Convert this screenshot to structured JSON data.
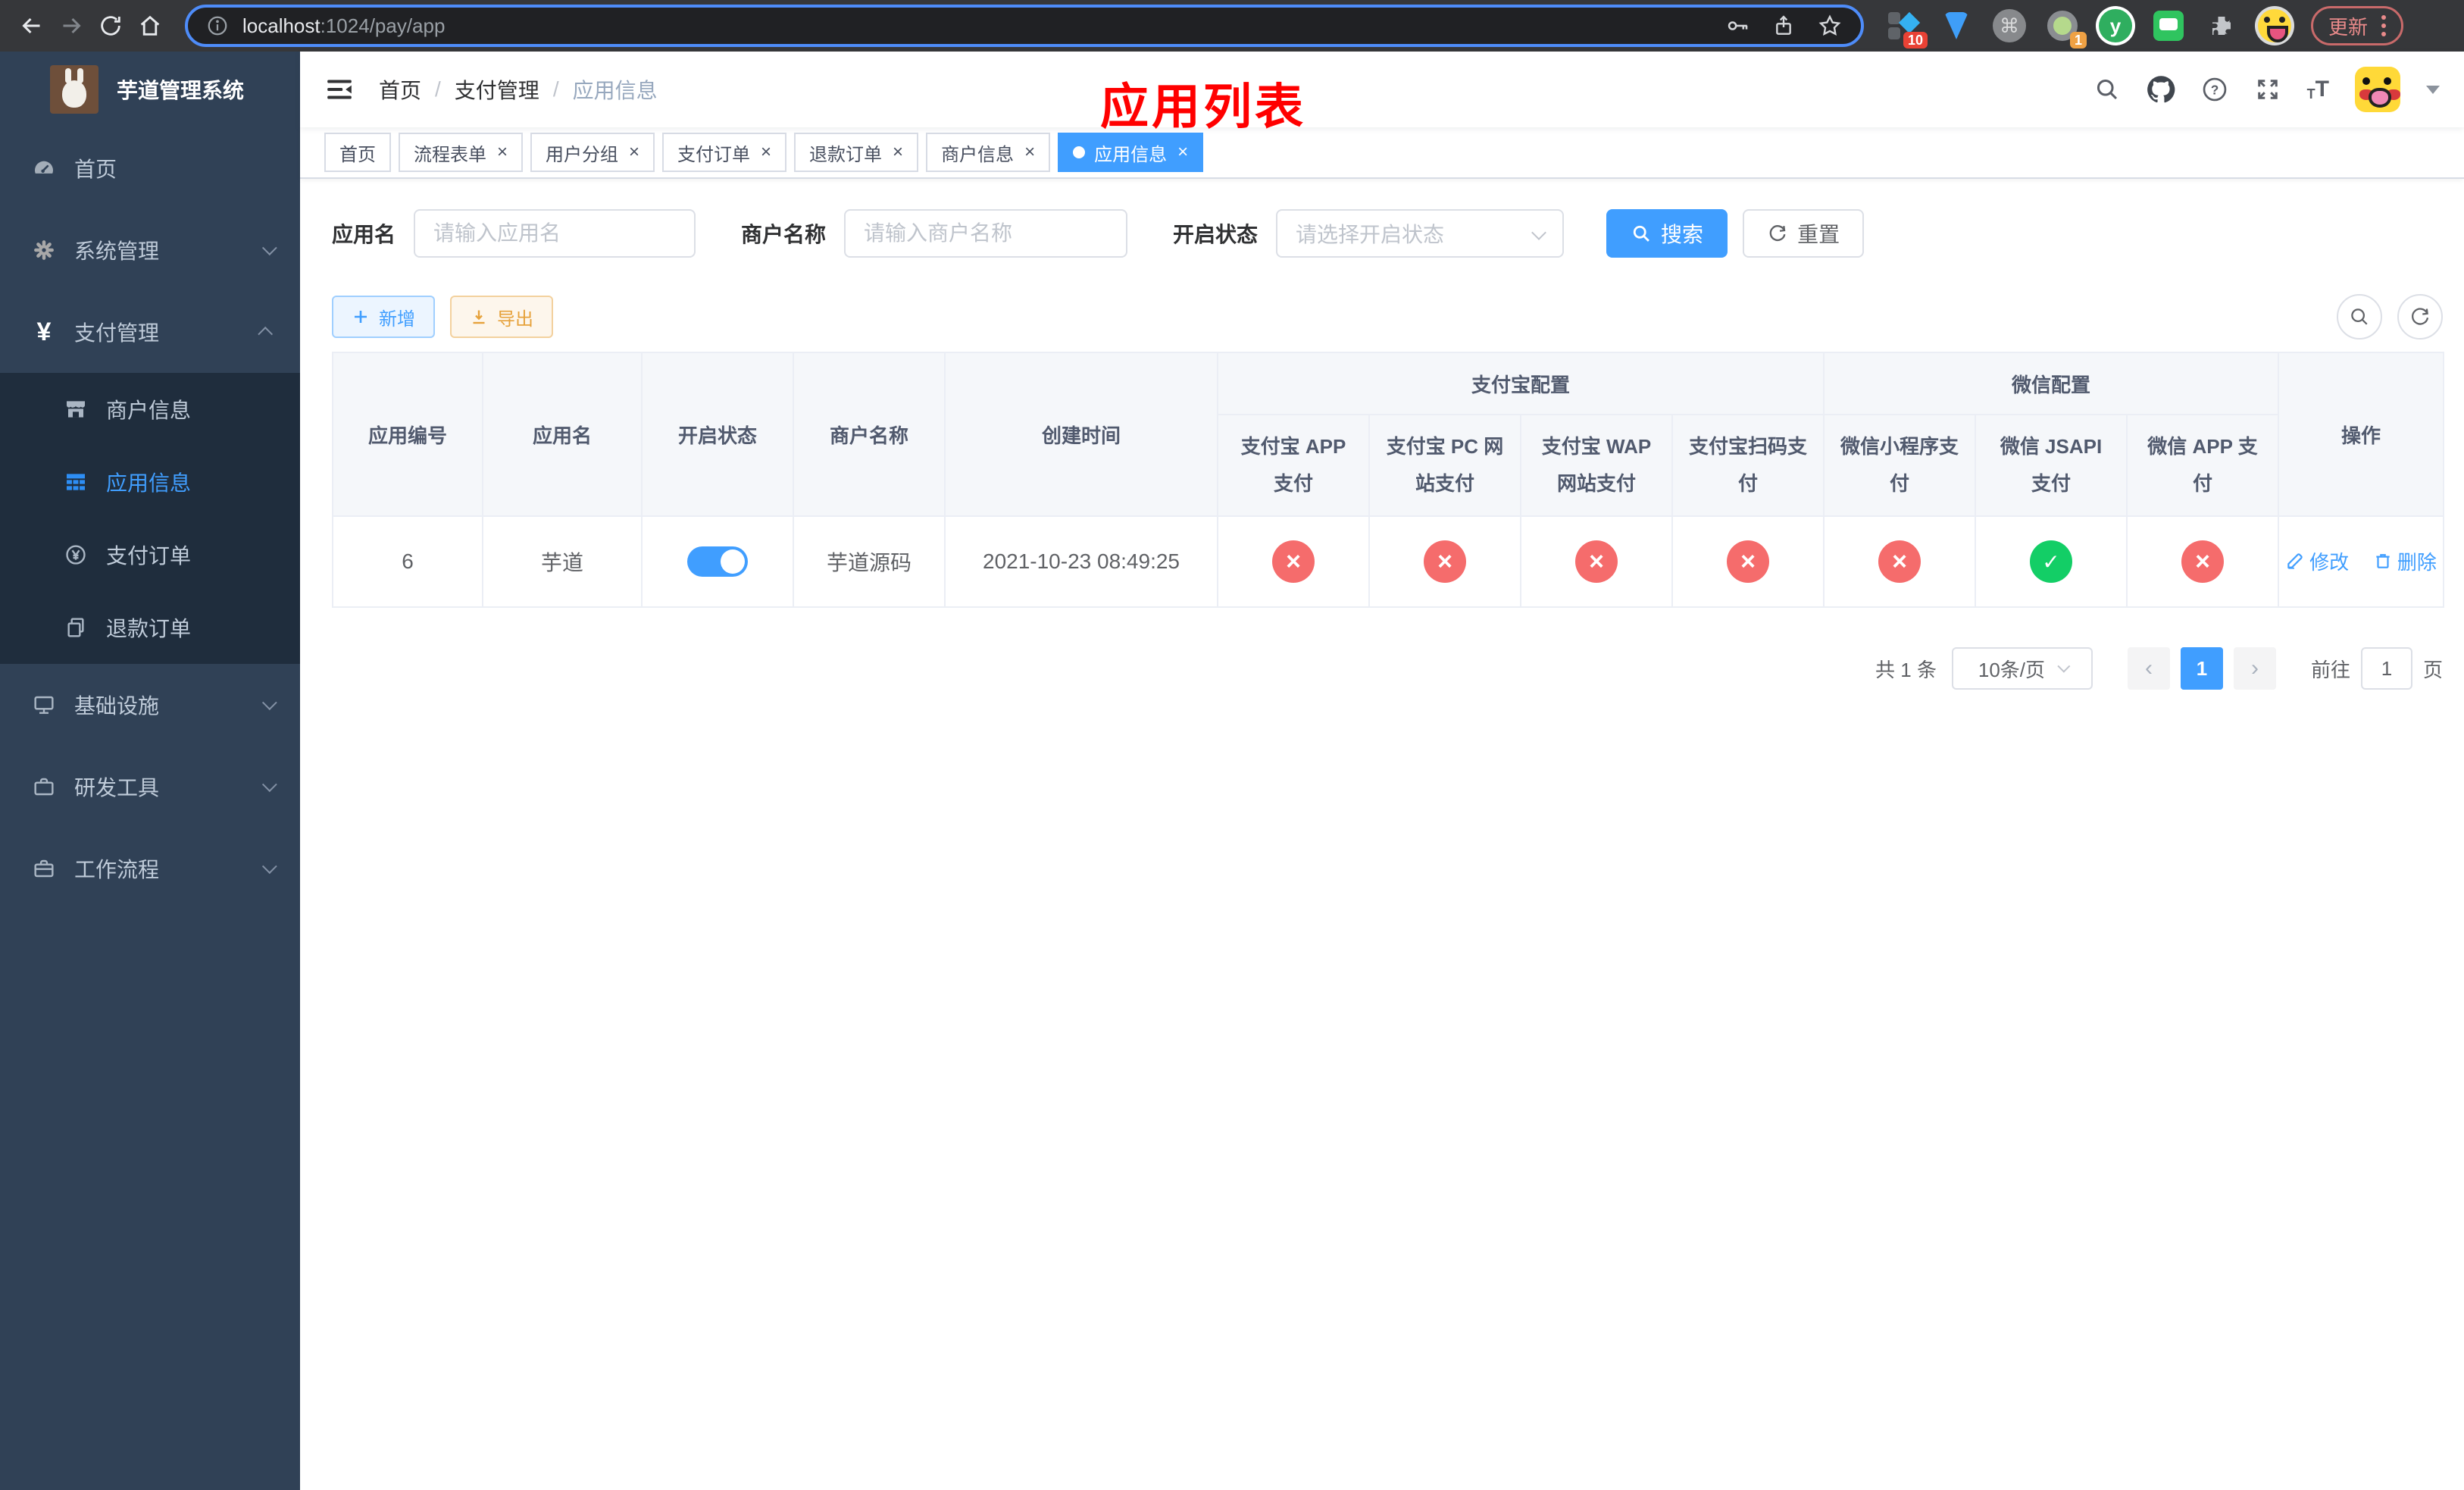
{
  "browser": {
    "url_host": "localhost",
    "url_path": ":1024/pay/app",
    "update_label": "更新",
    "ext_badge_10": "10",
    "ext_badge_1": "1"
  },
  "sidebar": {
    "title": "芋道管理系统",
    "items": [
      "首页",
      "系统管理",
      "支付管理",
      "商户信息",
      "应用信息",
      "支付订单",
      "退款订单",
      "基础设施",
      "研发工具",
      "工作流程"
    ]
  },
  "header": {
    "breadcrumb": [
      "首页",
      "支付管理",
      "应用信息"
    ],
    "overlay_title": "应用列表"
  },
  "tags": [
    "首页",
    "流程表单",
    "用户分组",
    "支付订单",
    "退款订单",
    "商户信息",
    "应用信息"
  ],
  "filters": {
    "app_name_label": "应用名",
    "app_name_placeholder": "请输入应用名",
    "merchant_label": "商户名称",
    "merchant_placeholder": "请输入商户名称",
    "status_label": "开启状态",
    "status_placeholder": "请选择开启状态",
    "search_label": "搜索",
    "reset_label": "重置"
  },
  "toolbar": {
    "add_label": "新增",
    "export_label": "导出"
  },
  "table": {
    "col_app_id": "应用编号",
    "col_app_name": "应用名",
    "col_status": "开启状态",
    "col_merchant": "商户名称",
    "col_created": "创建时间",
    "group_alipay": "支付宝配置",
    "group_wechat": "微信配置",
    "col_actions": "操作",
    "sub_cols": [
      "支付宝 APP 支付",
      "支付宝 PC 网站支付",
      "支付宝 WAP 网站支付",
      "支付宝扫码支付",
      "微信小程序支付",
      "微信 JSAPI 支付",
      "微信 APP 支付"
    ],
    "rows": [
      {
        "app_id": "6",
        "app_name": "芋道",
        "enabled": "on",
        "merchant": "芋道源码",
        "created": "2021-10-23 08:49:25",
        "channels": [
          "off",
          "off",
          "off",
          "off",
          "off",
          "on",
          "off"
        ],
        "edit_label": "修改",
        "delete_label": "删除"
      }
    ]
  },
  "pagination": {
    "total": "共 1 条",
    "page_size": "10条/页",
    "page": "1",
    "goto_label": "前往",
    "goto_value": "1",
    "goto_unit": "页"
  },
  "colors": {
    "primary": "#409eff",
    "success": "#13ce66",
    "danger": "#f56c6c",
    "warning": "#e6a23c",
    "annotation_red": "#ff0000",
    "sidebar_bg": "#304156",
    "submenu_bg": "#1f2d3d"
  }
}
